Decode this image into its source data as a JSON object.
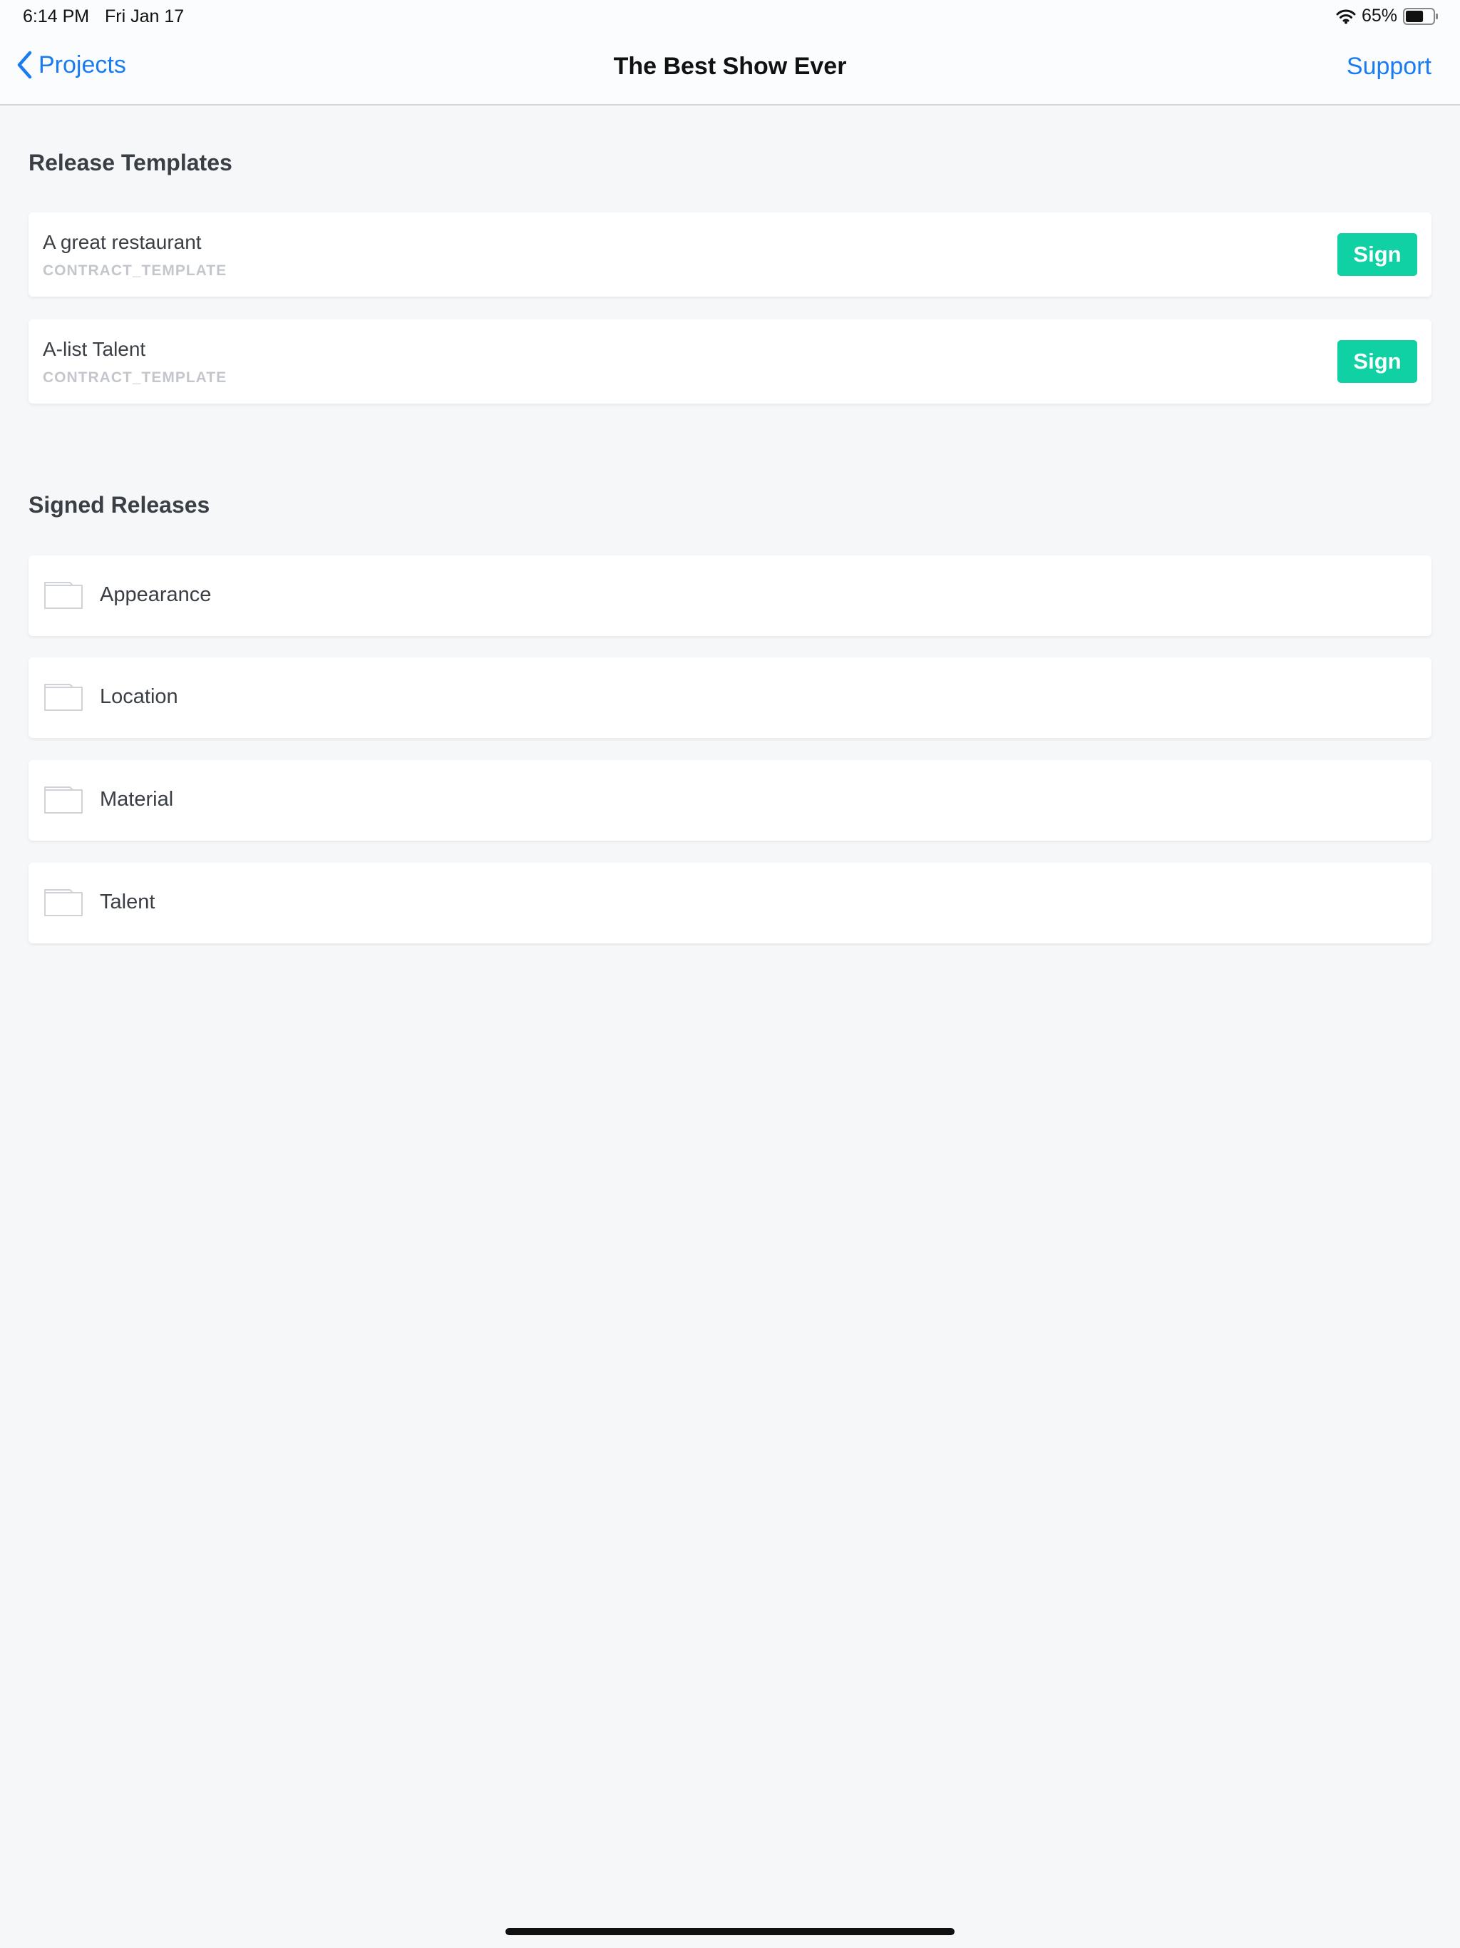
{
  "status_bar": {
    "time": "6:14 PM",
    "date": "Fri Jan 17",
    "battery": "65%",
    "battery_level": 0.65
  },
  "nav": {
    "back_label": "Projects",
    "title": "The Best Show Ever",
    "support_label": "Support"
  },
  "release_templates": {
    "heading": "Release Templates",
    "items": [
      {
        "name": "A great restaurant",
        "type": "CONTRACT_TEMPLATE",
        "action": "Sign"
      },
      {
        "name": "A-list Talent",
        "type": "CONTRACT_TEMPLATE",
        "action": "Sign"
      }
    ]
  },
  "signed_releases": {
    "heading": "Signed Releases",
    "items": [
      {
        "label": "Appearance",
        "icon": "folder-icon"
      },
      {
        "label": "Location",
        "icon": "folder-icon"
      },
      {
        "label": "Material",
        "icon": "folder-icon"
      },
      {
        "label": "Talent",
        "icon": "folder-icon"
      }
    ]
  },
  "colors": {
    "accent": "#1a7cf0",
    "sign_button": "#0fd1a4",
    "background": "#f6f7f9"
  }
}
